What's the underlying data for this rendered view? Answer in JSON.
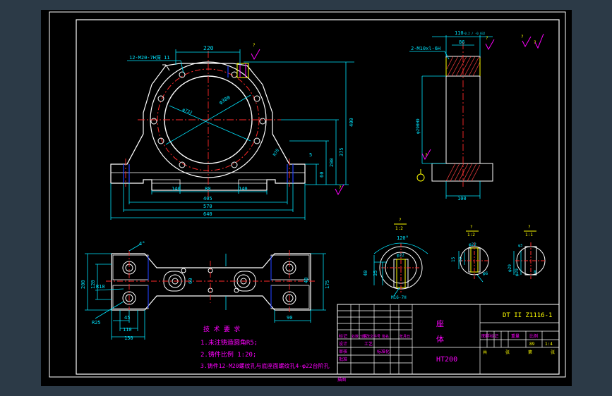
{
  "colors": {
    "background_outer": "#2c3a47",
    "canvas": "#000000",
    "outline": "#ffffff",
    "dimension": "#00e5ff",
    "center_line": "#ff2a2a",
    "annotation": "#ffff00",
    "accent": "#ff00ff",
    "hidden": "#2040ff",
    "hatch": "#ff4040"
  },
  "front_view": {
    "dims": {
      "top_width": "220",
      "hole_callout": "12-M20-7H深 11",
      "total_height": "400",
      "center_height": "375",
      "mid_height": "200",
      "base_height": "60",
      "rib_radius": "R70",
      "rib_angle": "5",
      "bottom_140_left": "140",
      "bottom_80": "80",
      "bottom_140_right": "140",
      "width_405": "405",
      "width_570": "570",
      "width_640": "640",
      "bore": "φ380",
      "inner_diam": "φ732"
    },
    "roughness_symbols": [
      "?",
      "?"
    ]
  },
  "side_view": {
    "dims": {
      "top_width": "110",
      "top_tol": "-0.2 / -0.032",
      "inner_width": "86",
      "thread_callout": "2-M10xl-6H",
      "bore_diam": "φ290H9",
      "bottom_width": "100"
    },
    "roughness_symbols": [
      "?",
      "?",
      "?",
      "?"
    ]
  },
  "top_view": {
    "dims": {
      "chamfer_left": "4°",
      "dim_200": "200",
      "dim_120": "120",
      "dim_60": "60",
      "dim_175": "175",
      "r18": "R18",
      "r25": "R25",
      "dim_45": "45",
      "dim_110": "110",
      "dim_150": "150",
      "dim_90": "90",
      "dim_40": "40"
    }
  },
  "details": [
    {
      "title_mark": "?",
      "scale": "1:2",
      "dims": [
        "120°",
        "φ22",
        "40",
        "35",
        "M16-7H"
      ]
    },
    {
      "title_mark": "?",
      "scale": "1:2",
      "dims": [
        "φ22",
        "15",
        "12",
        "φ6"
      ]
    },
    {
      "title_mark": "?",
      "scale": "1:1",
      "dims": [
        "φ3",
        "φ29",
        "φ29",
        "8"
      ]
    }
  ],
  "notes": {
    "title": "技 术 要 求",
    "items": [
      "1.未注铸造圆角R5;",
      "2.铸件比例 1:20;",
      "3.铸件12-M20螺纹孔与底座面螺纹孔4-φ22台阶孔"
    ]
  },
  "title_block": {
    "drawing_number": "DT II Z1116-1",
    "part_name_line1": "座",
    "part_name_line2": "体",
    "material": "HT200",
    "revision_row": [
      "标记",
      "处数",
      "分区",
      "更改文件号",
      "签名",
      "年月日"
    ],
    "left_rows": [
      "设计",
      "审核",
      "工艺",
      "批准"
    ],
    "left_col2": [
      "标准化"
    ],
    "right_header": [
      "图样标记",
      "重量",
      "比例"
    ],
    "weight": "89",
    "scale": "1:4",
    "sheet_row": [
      "共",
      "张",
      "第",
      "张"
    ],
    "bottom_stamp": "描图"
  }
}
